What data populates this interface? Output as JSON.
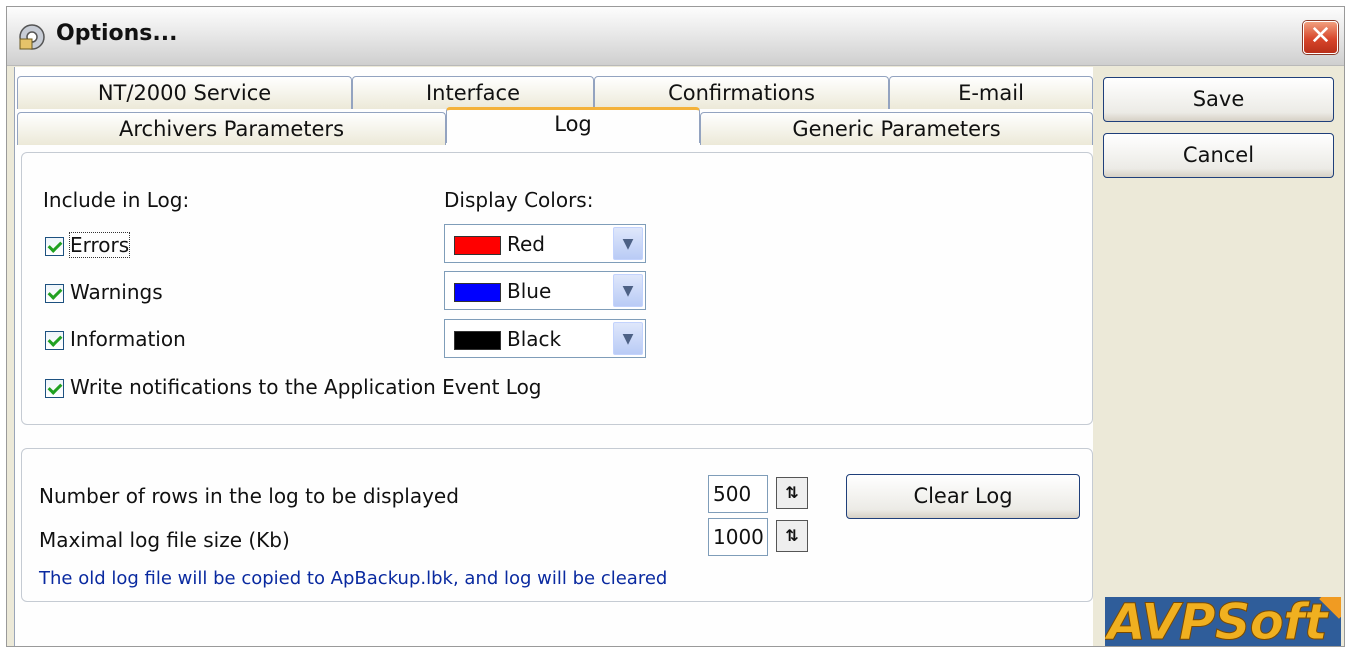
{
  "window": {
    "title": "Options...",
    "close": "✕"
  },
  "tabs": {
    "row1": [
      "NT/2000 Service",
      "Interface",
      "Confirmations",
      "E-mail"
    ],
    "row2": [
      "Archivers Parameters",
      "Log",
      "Generic Parameters"
    ],
    "active": "Log"
  },
  "log_group": {
    "include_heading": "Include in Log:",
    "colors_heading": "Display Colors:",
    "items": [
      {
        "label": "Errors",
        "checked": true,
        "color_name": "Red",
        "color": "#ff0000"
      },
      {
        "label": "Warnings",
        "checked": true,
        "color_name": "Blue",
        "color": "#0000ff"
      },
      {
        "label": "Information",
        "checked": true,
        "color_name": "Black",
        "color": "#000000"
      }
    ],
    "event_log": {
      "label": "Write notifications to the Application Event Log",
      "checked": true
    }
  },
  "size_group": {
    "rows_label": "Number of rows in the log to be displayed",
    "rows_value": "500",
    "size_label": "Maximal log file size (Kb)",
    "size_value": "1000",
    "clear_button": "Clear Log",
    "note": "The old log file will be copied to ApBackup.lbk, and log will be cleared"
  },
  "buttons": {
    "save": "Save",
    "cancel": "Cancel"
  },
  "logo": {
    "text": "AVPSoft"
  }
}
